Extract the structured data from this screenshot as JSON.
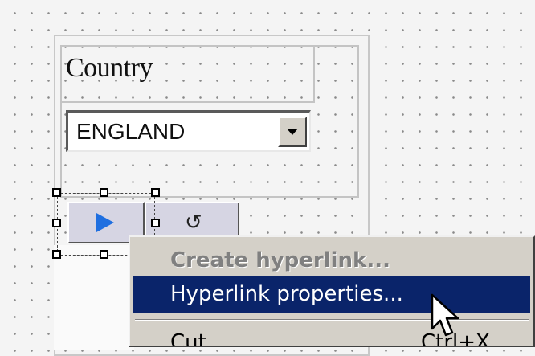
{
  "form": {
    "country_label": "Country",
    "country_select": {
      "selected_value": "ENGLAND"
    }
  },
  "buttons": [
    {
      "name": "play",
      "icon": "play-icon",
      "icon_color": "#1f6fe0"
    },
    {
      "name": "reset",
      "icon": "reset-icon",
      "glyph": "↺"
    }
  ],
  "context_menu": {
    "items": [
      {
        "label": "Create hyperlink...",
        "enabled": false
      },
      {
        "label": "Hyperlink properties...",
        "highlighted": true
      },
      {
        "label": "Cut",
        "shortcut": "Ctrl+X"
      }
    ],
    "highlight_color": "#0a246a"
  }
}
